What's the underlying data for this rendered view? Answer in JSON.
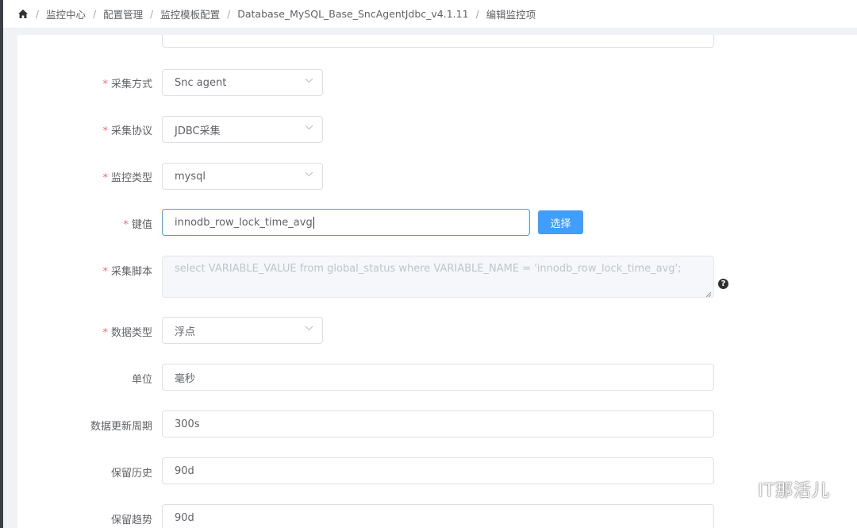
{
  "breadcrumb": {
    "items": [
      "监控中心",
      "配置管理",
      "监控模板配置",
      "Database_MySQL_Base_SncAgentJdbc_v4.1.11",
      "编辑监控项"
    ],
    "separator": "/"
  },
  "form": {
    "name_field": {
      "value": ""
    },
    "collect_method": {
      "label": "采集方式",
      "value": "Snc agent"
    },
    "collect_protocol": {
      "label": "采集协议",
      "value": "JDBC采集"
    },
    "monitor_type": {
      "label": "监控类型",
      "value": "mysql"
    },
    "key": {
      "label": "键值",
      "value": "innodb_row_lock_time_avg",
      "button_label": "选择"
    },
    "script": {
      "label": "采集脚本",
      "value": "select VARIABLE_VALUE from global_status where VARIABLE_NAME = 'innodb_row_lock_time_avg';",
      "help": "?"
    },
    "data_type": {
      "label": "数据类型",
      "value": "浮点"
    },
    "unit": {
      "label": "单位",
      "value": "毫秒"
    },
    "update_interval": {
      "label": "数据更新周期",
      "value": "300s"
    },
    "history": {
      "label": "保留历史",
      "value": "90d"
    },
    "trends": {
      "label": "保留趋势",
      "value": "90d"
    },
    "required_mark": "*"
  },
  "watermark": {
    "text": "IT那活儿"
  },
  "colors": {
    "primary": "#409eff",
    "required": "#f56c6c",
    "text": "#606266",
    "border": "#dcdfe6"
  }
}
